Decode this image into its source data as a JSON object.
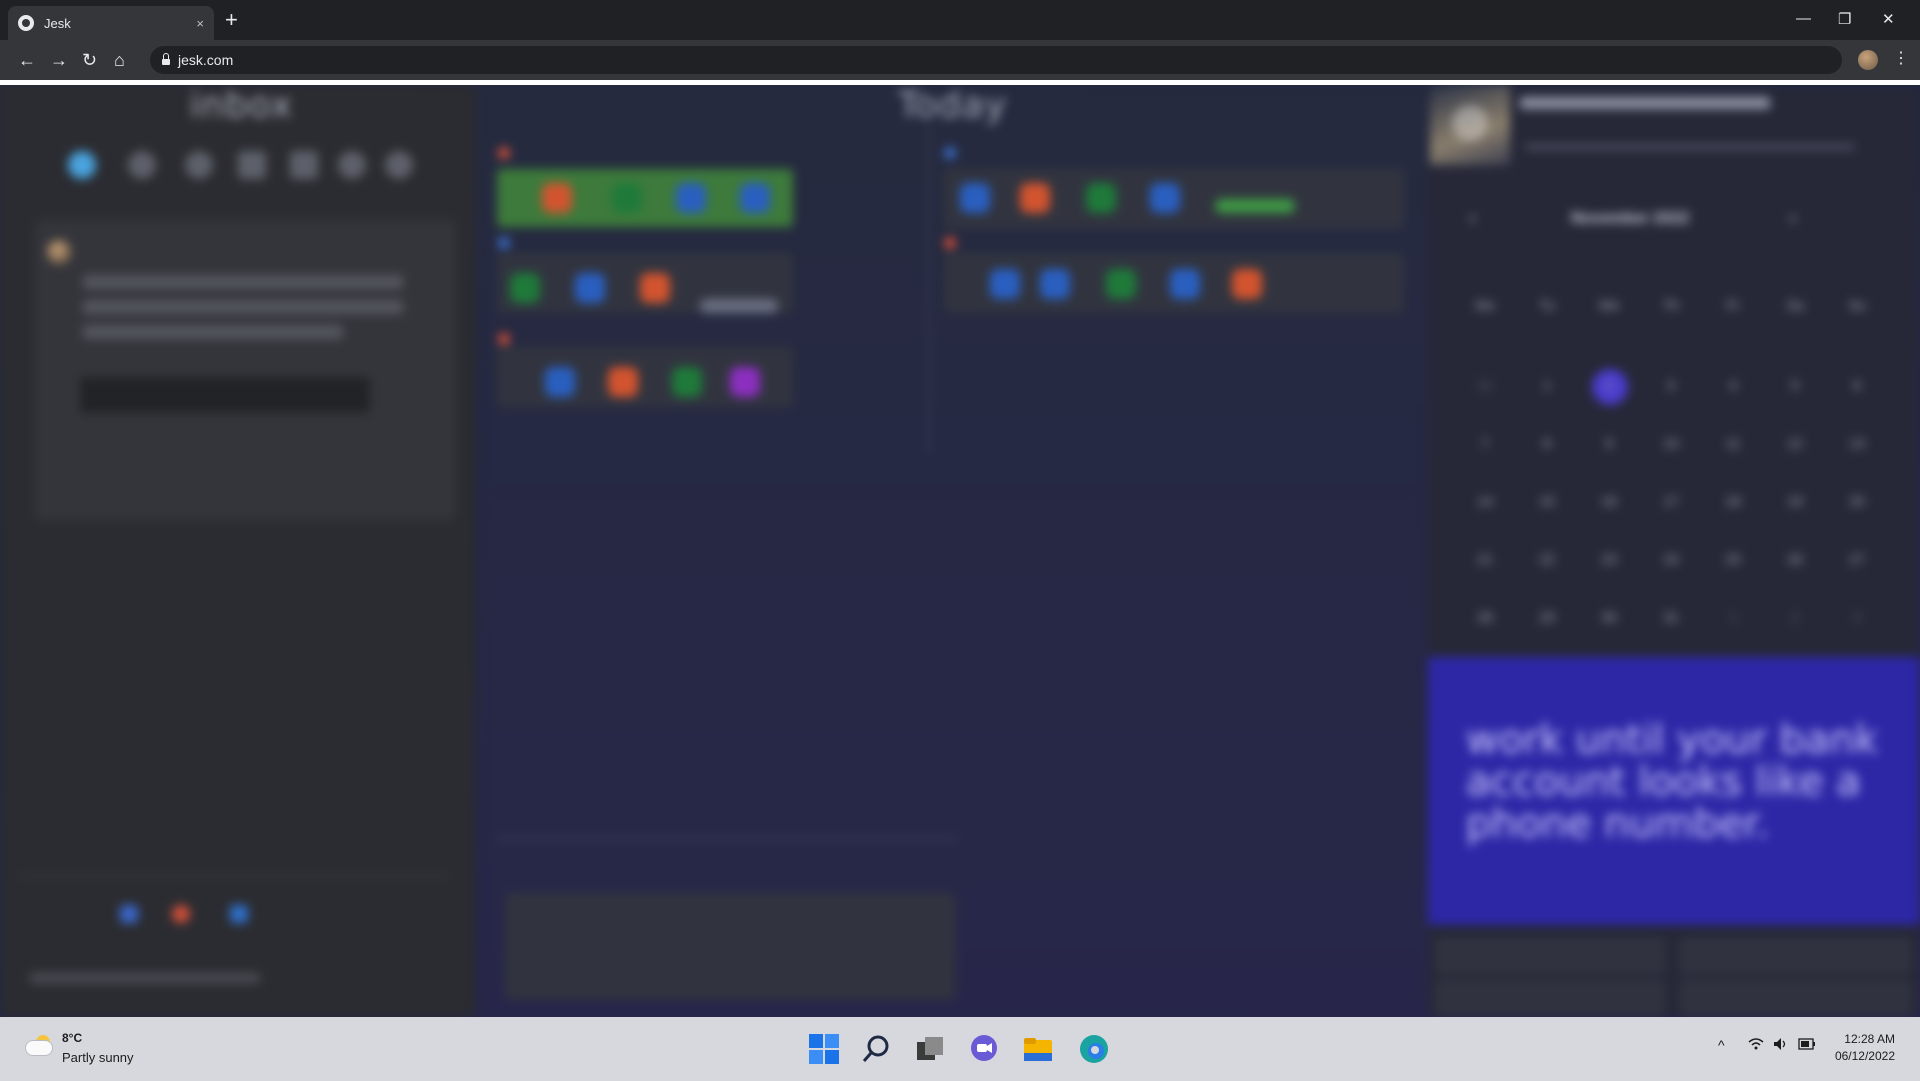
{
  "browser": {
    "tab_title": "Jesk",
    "tab_close": "×",
    "new_tab": "+",
    "url": "jesk.com",
    "controls": {
      "minimize": "—",
      "restore": "❐",
      "close": "✕"
    },
    "nav": {
      "back": "←",
      "forward": "→",
      "reload": "↻",
      "home": "⌂",
      "menu": "⋮"
    }
  },
  "page": {
    "inbox_title": "inbox",
    "today_title": "Today",
    "calendar": {
      "month": "November 2022",
      "prev": "‹",
      "next": "›",
      "weekdays": [
        "Mo",
        "Tu",
        "We",
        "Th",
        "Fr",
        "Sa",
        "Su"
      ],
      "weeks": [
        [
          "31",
          "1",
          "2",
          "3",
          "4",
          "5",
          "6"
        ],
        [
          "7",
          "8",
          "9",
          "10",
          "11",
          "12",
          "13"
        ],
        [
          "14",
          "15",
          "16",
          "17",
          "18",
          "19",
          "20"
        ],
        [
          "21",
          "22",
          "23",
          "24",
          "25",
          "26",
          "27"
        ],
        [
          "28",
          "29",
          "30",
          "31",
          "1",
          "2",
          "3"
        ]
      ],
      "selected_day": "2"
    },
    "quote": "work until your bank account looks like a phone number."
  },
  "taskbar": {
    "weather_temp": "8°C",
    "weather_cond": "Partly sunny",
    "time": "12:28 AM",
    "date": "06/12/2022",
    "tray_up": "^"
  },
  "colors": {
    "accent_selected": "#4b3ccc",
    "quote_bg": "#2d27a6",
    "strip_green": "#3d7a3b"
  }
}
